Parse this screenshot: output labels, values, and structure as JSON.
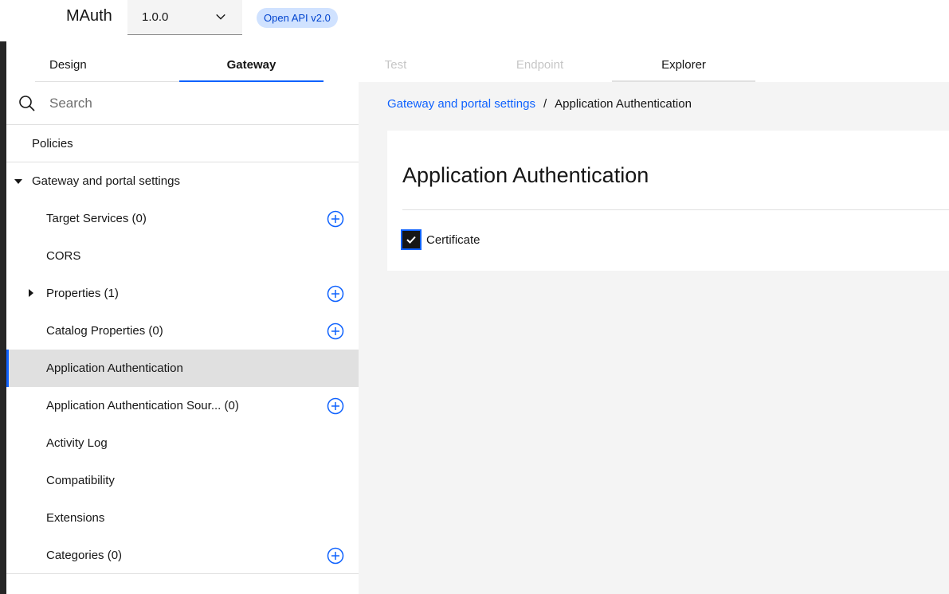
{
  "header": {
    "app_title": "MAuth",
    "version": "1.0.0",
    "api_tag": "Open API v2.0"
  },
  "tabs": [
    {
      "label": "Design",
      "state": "normal"
    },
    {
      "label": "Gateway",
      "state": "active"
    },
    {
      "label": "Test",
      "state": "disabled"
    },
    {
      "label": "Endpoint",
      "state": "disabled"
    },
    {
      "label": "Explorer",
      "state": "normal"
    }
  ],
  "sidebar": {
    "search_placeholder": "Search",
    "policies_label": "Policies",
    "section_label": "Gateway and portal settings",
    "items": [
      {
        "label": "Target Services (0)",
        "has_add": true
      },
      {
        "label": "CORS",
        "has_add": false
      },
      {
        "label": "Properties (1)",
        "has_add": true,
        "expandable": true
      },
      {
        "label": "Catalog Properties (0)",
        "has_add": true
      },
      {
        "label": "Application Authentication",
        "has_add": false,
        "selected": true
      },
      {
        "label": "Application Authentication Sour... (0)",
        "has_add": true
      },
      {
        "label": "Activity Log",
        "has_add": false
      },
      {
        "label": "Compatibility",
        "has_add": false
      },
      {
        "label": "Extensions",
        "has_add": false
      },
      {
        "label": "Categories (0)",
        "has_add": true
      }
    ]
  },
  "main": {
    "breadcrumb_link": "Gateway and portal settings",
    "breadcrumb_separator": "/",
    "breadcrumb_current": "Application Authentication",
    "title": "Application Authentication",
    "certificate_label": "Certificate",
    "certificate_checked": true
  },
  "colors": {
    "accent": "#0f62fe",
    "tag_bg": "#d0e2ff",
    "tag_text": "#0043ce",
    "main_bg": "#f4f4f4"
  }
}
